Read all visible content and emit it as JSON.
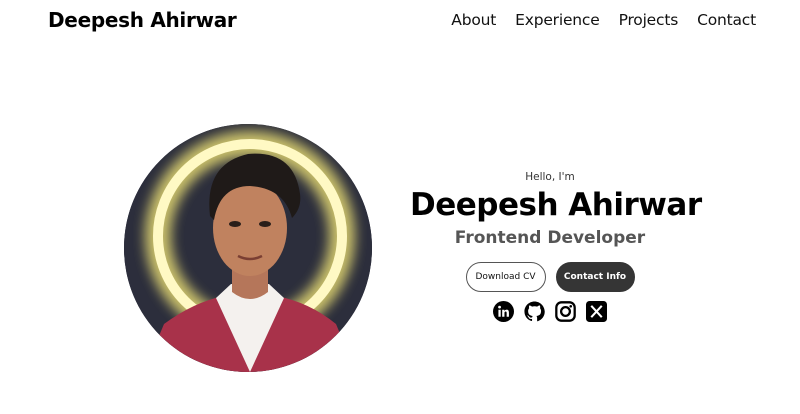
{
  "header": {
    "logo": "Deepesh Ahirwar",
    "nav": [
      "About",
      "Experience",
      "Projects",
      "Contact"
    ]
  },
  "hero": {
    "greeting": "Hello, I'm",
    "name": "Deepesh Ahirwar",
    "role": "Frontend Developer",
    "buttons": {
      "download_cv": "Download CV",
      "contact_info": "Contact Info"
    },
    "socials": [
      "linkedin-icon",
      "github-icon",
      "instagram-icon",
      "x-icon"
    ]
  },
  "colors": {
    "text": "#000000",
    "role": "#555555",
    "dark_button": "#353535",
    "profile_bg": "#2c2e3c",
    "glow": "#fff59a"
  }
}
